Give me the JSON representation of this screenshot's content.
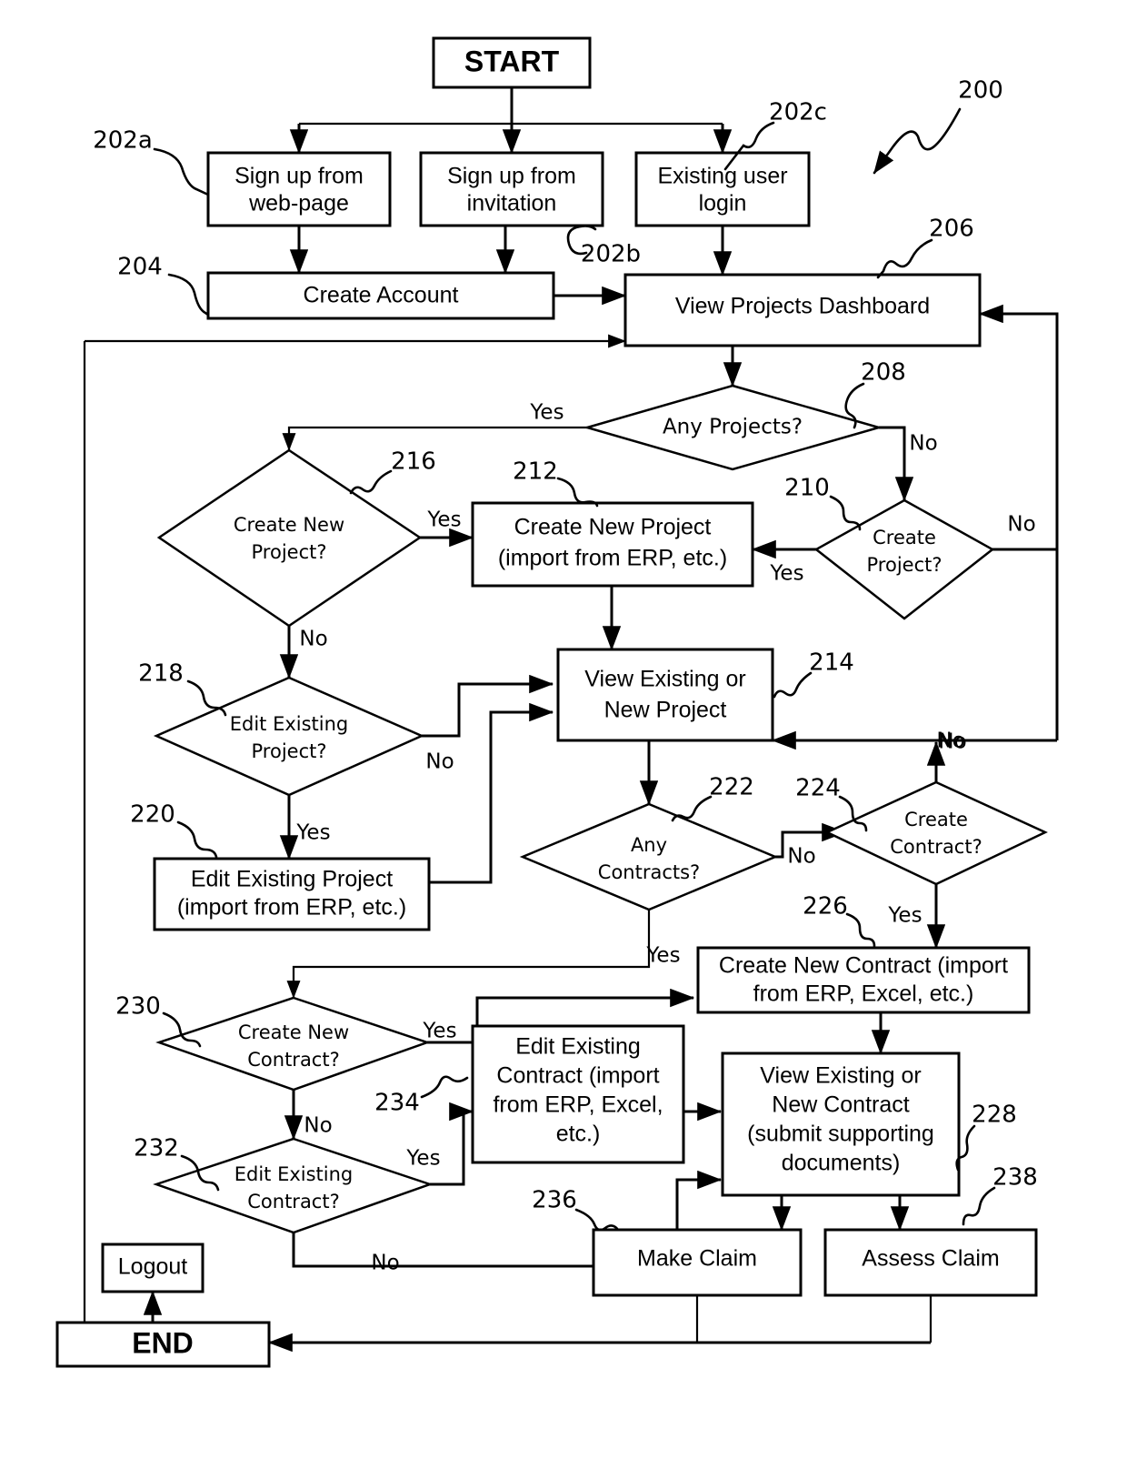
{
  "figure": {
    "reference_number": "200",
    "title": "Flowchart of user workflow for project and contract management system"
  },
  "nodes": {
    "start": {
      "label": "START",
      "ref": ""
    },
    "signup_web": {
      "label_line1": "Sign up from",
      "label_line2": "web-page",
      "ref": "202a"
    },
    "signup_invite": {
      "label_line1": "Sign up from",
      "label_line2": "invitation",
      "ref": "202b"
    },
    "existing_login": {
      "label_line1": "Existing user",
      "label_line2": "login",
      "ref": "202c"
    },
    "create_account": {
      "label": "Create Account",
      "ref": "204"
    },
    "view_dashboard": {
      "label": "View Projects Dashboard",
      "ref": "206"
    },
    "any_projects": {
      "label": "Any Projects?",
      "ref": "208"
    },
    "create_project_q": {
      "label_line1": "Create",
      "label_line2": "Project?",
      "ref": "210"
    },
    "create_new_project": {
      "label_line1": "Create New Project",
      "label_line2": "(import from ERP, etc.)",
      "ref": "212"
    },
    "view_project": {
      "label_line1": "View Existing or",
      "label_line2": "New Project",
      "ref": "214"
    },
    "create_new_project_q": {
      "label_line1": "Create New",
      "label_line2": "Project?",
      "ref": "216"
    },
    "edit_existing_project_q": {
      "label_line1": "Edit Existing",
      "label_line2": "Project?",
      "ref": "218"
    },
    "edit_existing_project": {
      "label_line1": "Edit Existing Project",
      "label_line2": "(import from ERP, etc.)",
      "ref": "220"
    },
    "any_contracts": {
      "label_line1": "Any",
      "label_line2": "Contracts?",
      "ref": "222"
    },
    "create_contract_q": {
      "label_line1": "Create",
      "label_line2": "Contract?",
      "ref": "224"
    },
    "create_new_contract": {
      "label_line1": "Create New Contract (import",
      "label_line2": "from ERP, Excel, etc.)",
      "ref": "226"
    },
    "view_contract": {
      "label_line1": "View Existing or",
      "label_line2": "New Contract",
      "label_line3": "(submit supporting",
      "label_line4": "documents)",
      "ref": "228"
    },
    "create_new_contract_q": {
      "label_line1": "Create New",
      "label_line2": "Contract?",
      "ref": "230"
    },
    "edit_existing_contract_q": {
      "label_line1": "Edit Existing",
      "label_line2": "Contract?",
      "ref": "232"
    },
    "edit_existing_contract": {
      "label_line1": "Edit Existing",
      "label_line2": "Contract (import",
      "label_line3": "from ERP, Excel,",
      "label_line4": "etc.)",
      "ref": "234"
    },
    "make_claim": {
      "label": "Make Claim",
      "ref": "236"
    },
    "assess_claim": {
      "label": "Assess Claim",
      "ref": "238"
    },
    "logout": {
      "label": "Logout",
      "ref": ""
    },
    "end": {
      "label": "END",
      "ref": ""
    }
  },
  "edge_labels": {
    "any_projects_yes": "Yes",
    "any_projects_no": "No",
    "create_project_yes": "Yes",
    "create_project_no": "No",
    "create_new_project_yes": "Yes",
    "create_new_project_no": "No",
    "edit_existing_project_no": "No",
    "edit_existing_project_yes": "Yes",
    "any_contracts_no": "No",
    "any_contracts_yes": "Yes",
    "create_contract_no": "No",
    "create_contract_yes": "Yes",
    "create_new_contract_yes": "Yes",
    "create_new_contract_no": "No",
    "edit_existing_contract_yes": "Yes",
    "edit_existing_contract_no": "No",
    "view_project_right_no": "No"
  },
  "colors": {
    "stroke": "#000000",
    "fill": "#ffffff",
    "text": "#000000"
  }
}
